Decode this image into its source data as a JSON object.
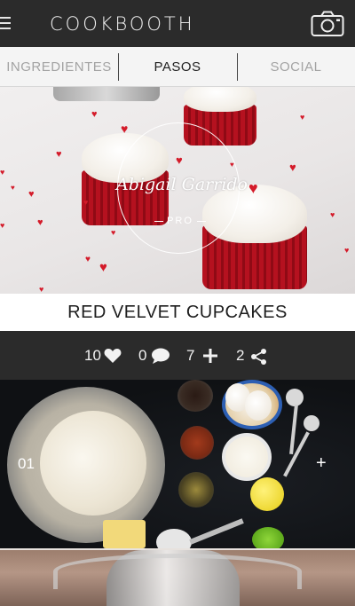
{
  "app": {
    "logo": "COOKBOOTH"
  },
  "tabs": [
    {
      "label": "INGREDIENTES",
      "active": false
    },
    {
      "label": "PASOS",
      "active": true
    },
    {
      "label": "SOCIAL",
      "active": false
    }
  ],
  "hero": {
    "author_name": "Abigail Garrido",
    "author_badge": "PRO"
  },
  "recipe": {
    "title": "RED VELVET CUPCAKES"
  },
  "stats": {
    "likes": "10",
    "comments": "0",
    "adds": "7",
    "shares": "2"
  },
  "steps": [
    {
      "number": "01",
      "action": "+"
    }
  ],
  "colors": {
    "bar_dark": "#2b2b2b",
    "accent_red": "#d41b2a",
    "tab_active": "#222222",
    "tab_inactive": "#a3a3a3"
  },
  "icons": [
    "menu-icon",
    "camera-icon",
    "heart-icon",
    "comment-icon",
    "plus-icon",
    "share-icon"
  ]
}
